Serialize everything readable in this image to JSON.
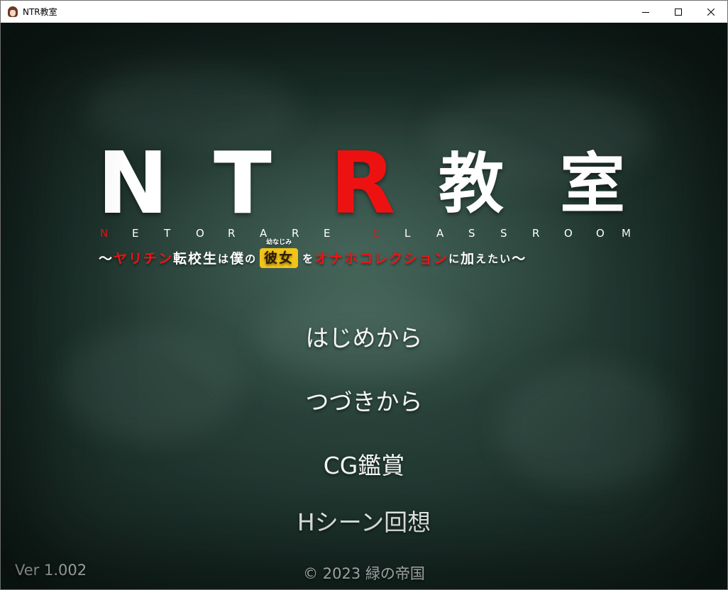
{
  "window": {
    "title": "NTR教室",
    "controls": [
      "minimize-icon",
      "maximize-icon",
      "close-icon"
    ]
  },
  "logo": {
    "letters": [
      "N",
      "T",
      "R",
      "教",
      "室"
    ],
    "subtitle_letters": [
      "N",
      "E",
      "T",
      "O",
      "R",
      "A",
      "R",
      "E",
      "C",
      "L",
      "A",
      "S",
      "S",
      "R",
      "O",
      "O",
      "M"
    ],
    "tagline": {
      "open": "〜",
      "part1": "ヤリチン",
      "part2": "転校生",
      "part3": "は",
      "part4": "僕",
      "part5": "の",
      "highlight": "彼女",
      "highlight_ruby": "幼なじみ",
      "part6": "を",
      "part7": "オナホコレクション",
      "part8": "に",
      "part9": "加",
      "part10": "えたい",
      "close": "〜"
    },
    "colors": {
      "white": "#ffffff",
      "red": "#ee1111",
      "highlight": "#f2c419"
    }
  },
  "menu": {
    "items": [
      {
        "label": "はじめから"
      },
      {
        "label": "つづきから"
      },
      {
        "label": "CG鑑賞"
      },
      {
        "label": "Hシーン回想"
      }
    ]
  },
  "footer": {
    "version": "Ver 1.002",
    "copyright": "© 2023 緑の帝国"
  },
  "theme": {
    "chalkboard": "#2f4a41",
    "text": "#f4f6f5"
  }
}
